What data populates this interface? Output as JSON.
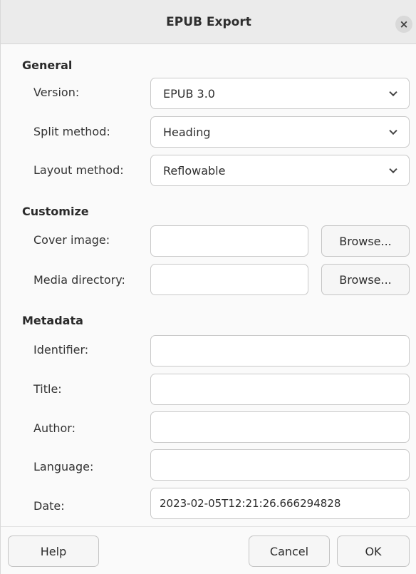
{
  "dialog": {
    "title": "EPUB Export",
    "close_glyph": "×",
    "close_icon": "close-icon"
  },
  "general": {
    "heading": "General",
    "version": {
      "label": "Version:",
      "value": "EPUB 3.0"
    },
    "split_method": {
      "label": "Split method:",
      "value": "Heading"
    },
    "layout_method": {
      "label": "Layout method:",
      "value": "Reflowable"
    },
    "dropdown_icon": "chevron-down-icon"
  },
  "customize": {
    "heading": "Customize",
    "cover_image": {
      "label": "Cover image:",
      "value": "",
      "browse_label": "Browse..."
    },
    "media_directory": {
      "label": "Media directory:",
      "value": "",
      "browse_label": "Browse..."
    }
  },
  "metadata": {
    "heading": "Metadata",
    "identifier": {
      "label": "Identifier:",
      "value": ""
    },
    "title": {
      "label": "Title:",
      "value": ""
    },
    "author": {
      "label": "Author:",
      "value": ""
    },
    "language": {
      "label": "Language:",
      "value": ""
    },
    "date": {
      "label": "Date:",
      "value": "2023-02-05T12:21:26.666294828"
    }
  },
  "footer": {
    "help_label": "Help",
    "cancel_label": "Cancel",
    "ok_label": "OK"
  }
}
